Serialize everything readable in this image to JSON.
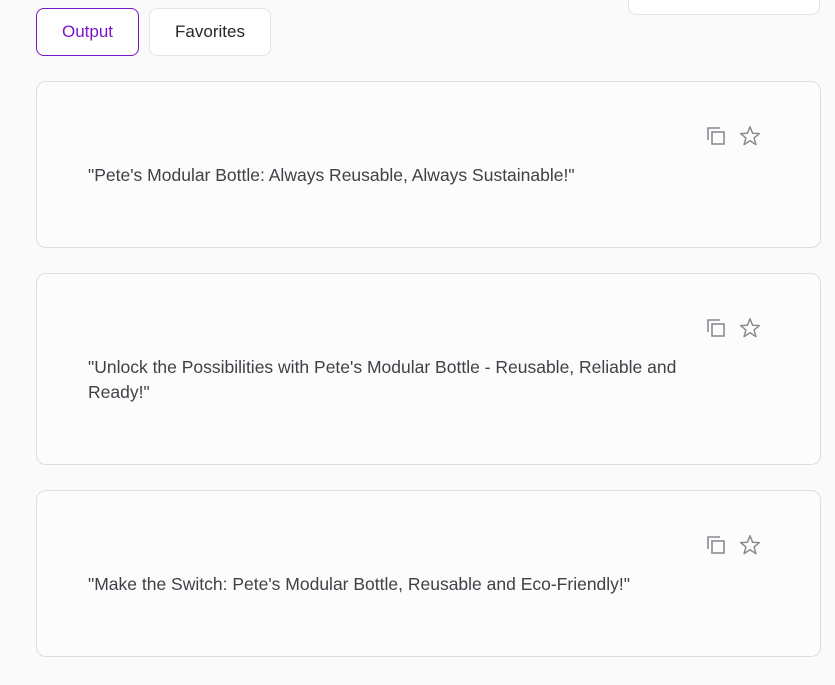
{
  "tabs": {
    "output_label": "Output",
    "favorites_label": "Favorites"
  },
  "results": [
    {
      "text": "\"Pete's Modular Bottle: Always Reusable, Always Sustainable!\""
    },
    {
      "text": "\"Unlock the Possibilities with Pete's Modular Bottle - Reusable, Reliable and Ready!\""
    },
    {
      "text": "\"Make the Switch: Pete's Modular Bottle, Reusable and Eco-Friendly!\""
    }
  ],
  "icons": {
    "copy": "copy-icon",
    "favorite": "star-icon"
  },
  "colors": {
    "accent": "#7c15c7",
    "text": "#404047",
    "border": "#dedde6",
    "icon": "#8a8a90"
  }
}
